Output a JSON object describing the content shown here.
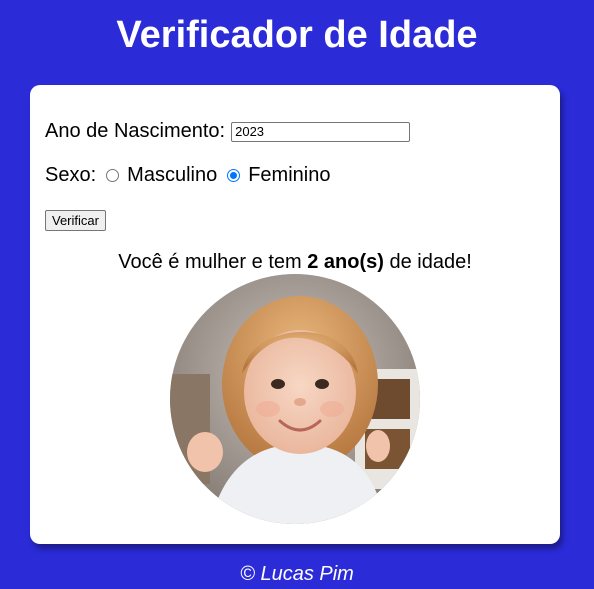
{
  "header": {
    "title": "Verificador de Idade"
  },
  "form": {
    "year_label": "Ano de Nascimento:",
    "year_value": "2023",
    "sex_label": "Sexo:",
    "sex_options": [
      {
        "label": "Masculino",
        "checked": false
      },
      {
        "label": "Feminino",
        "checked": true
      }
    ],
    "submit_label": "Verificar"
  },
  "result": {
    "prefix": "Você é mulher e tem ",
    "age": "2 ano(s)",
    "suffix": " de idade!"
  },
  "footer": {
    "text": "© Lucas Pim"
  },
  "colors": {
    "background": "#2b2bd8",
    "card": "#ffffff",
    "radio_accent": "#0075ff"
  }
}
